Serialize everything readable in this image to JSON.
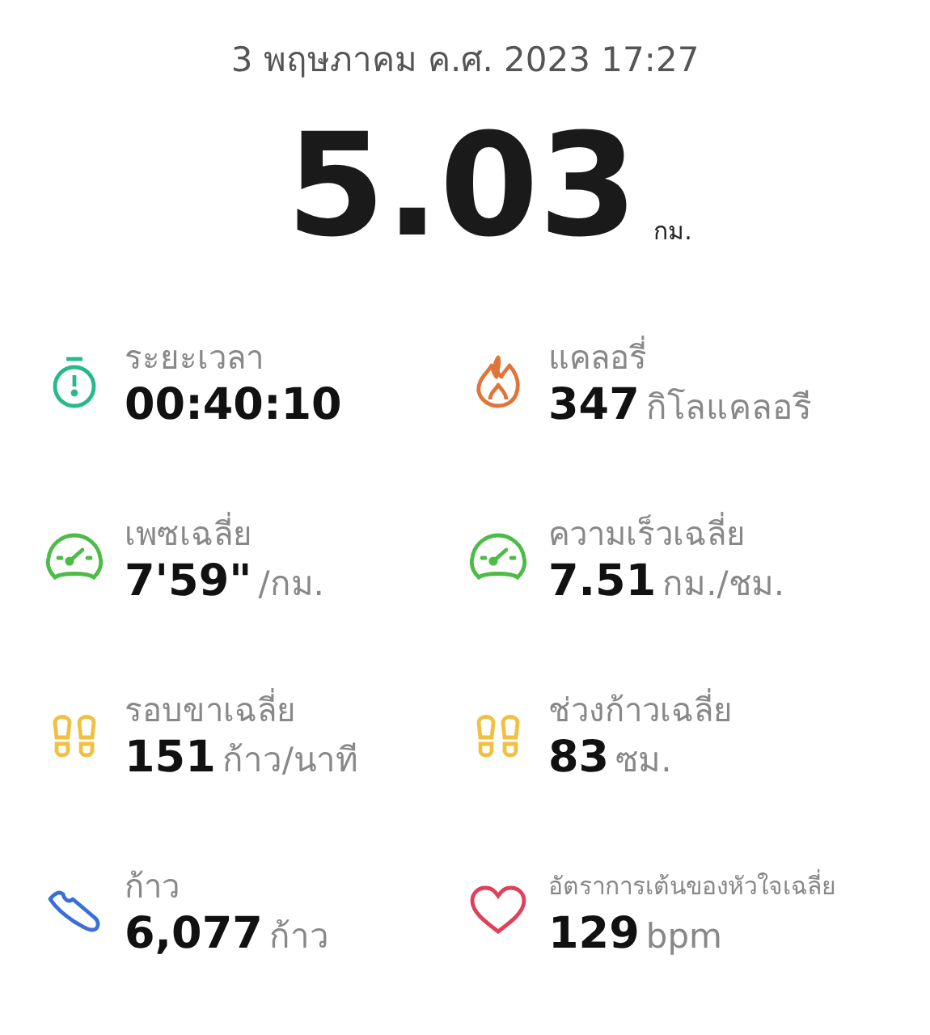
{
  "date": "3 พฤษภาคม ค.ศ. 2023 17:27",
  "distance": {
    "value": "5.03",
    "unit": "กม."
  },
  "stats": [
    {
      "kind": "stopwatch",
      "label": "ระยะเวลา",
      "value": "00:40:10"
    },
    {
      "kind": "flame",
      "label": "แคลอรี่",
      "value": "347",
      "unit": "กิโลแคลอรี"
    },
    {
      "kind": "gauge",
      "label": "เพซเฉลี่ย",
      "value": "7'59\"",
      "unit": "/กม."
    },
    {
      "kind": "gauge",
      "label": "ความเร็วเฉลี่ย",
      "value": "7.51",
      "unit": "กม./ชม."
    },
    {
      "kind": "footprints",
      "label": "รอบขาเฉลี่ย",
      "value": "151",
      "unit": "ก้าว/นาที"
    },
    {
      "kind": "footprints",
      "label": "ช่วงก้าวเฉลี่ย",
      "value": "83",
      "unit": "ซม."
    },
    {
      "kind": "shoe",
      "label": "ก้าว",
      "value": "6,077",
      "unit": "ก้าว"
    },
    {
      "kind": "heart",
      "label": "อัตราการเต้นของหัวใจเฉลี่ย",
      "value": "129",
      "unit": "bpm"
    }
  ]
}
